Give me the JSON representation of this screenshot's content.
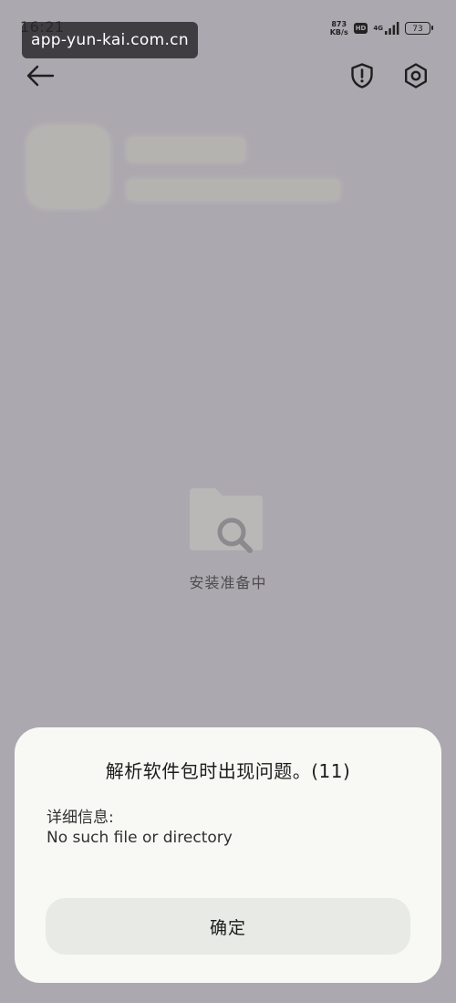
{
  "status_bar": {
    "time": "16:21",
    "net_speed_value": "873",
    "net_speed_unit": "KB/s",
    "hd_badge": "HD",
    "network_type": "4G",
    "battery": "73"
  },
  "url_toast": {
    "text": "app-yun-kai.com.cn"
  },
  "header": {
    "back_icon": "arrow-left-icon",
    "shield_icon": "shield-exclamation-icon",
    "settings_icon": "gear-icon"
  },
  "center": {
    "icon": "folder-search-icon",
    "status_text": "安装准备中"
  },
  "dialog": {
    "title": "解析软件包时出现问题。(11)",
    "detail_label": "详细信息:",
    "detail_message": "No such file or directory",
    "confirm_label": "确定"
  },
  "colors": {
    "overlay_background": "#ACA8AF",
    "dialog_background": "#F8F9F4",
    "button_background": "#E8EAE5"
  }
}
